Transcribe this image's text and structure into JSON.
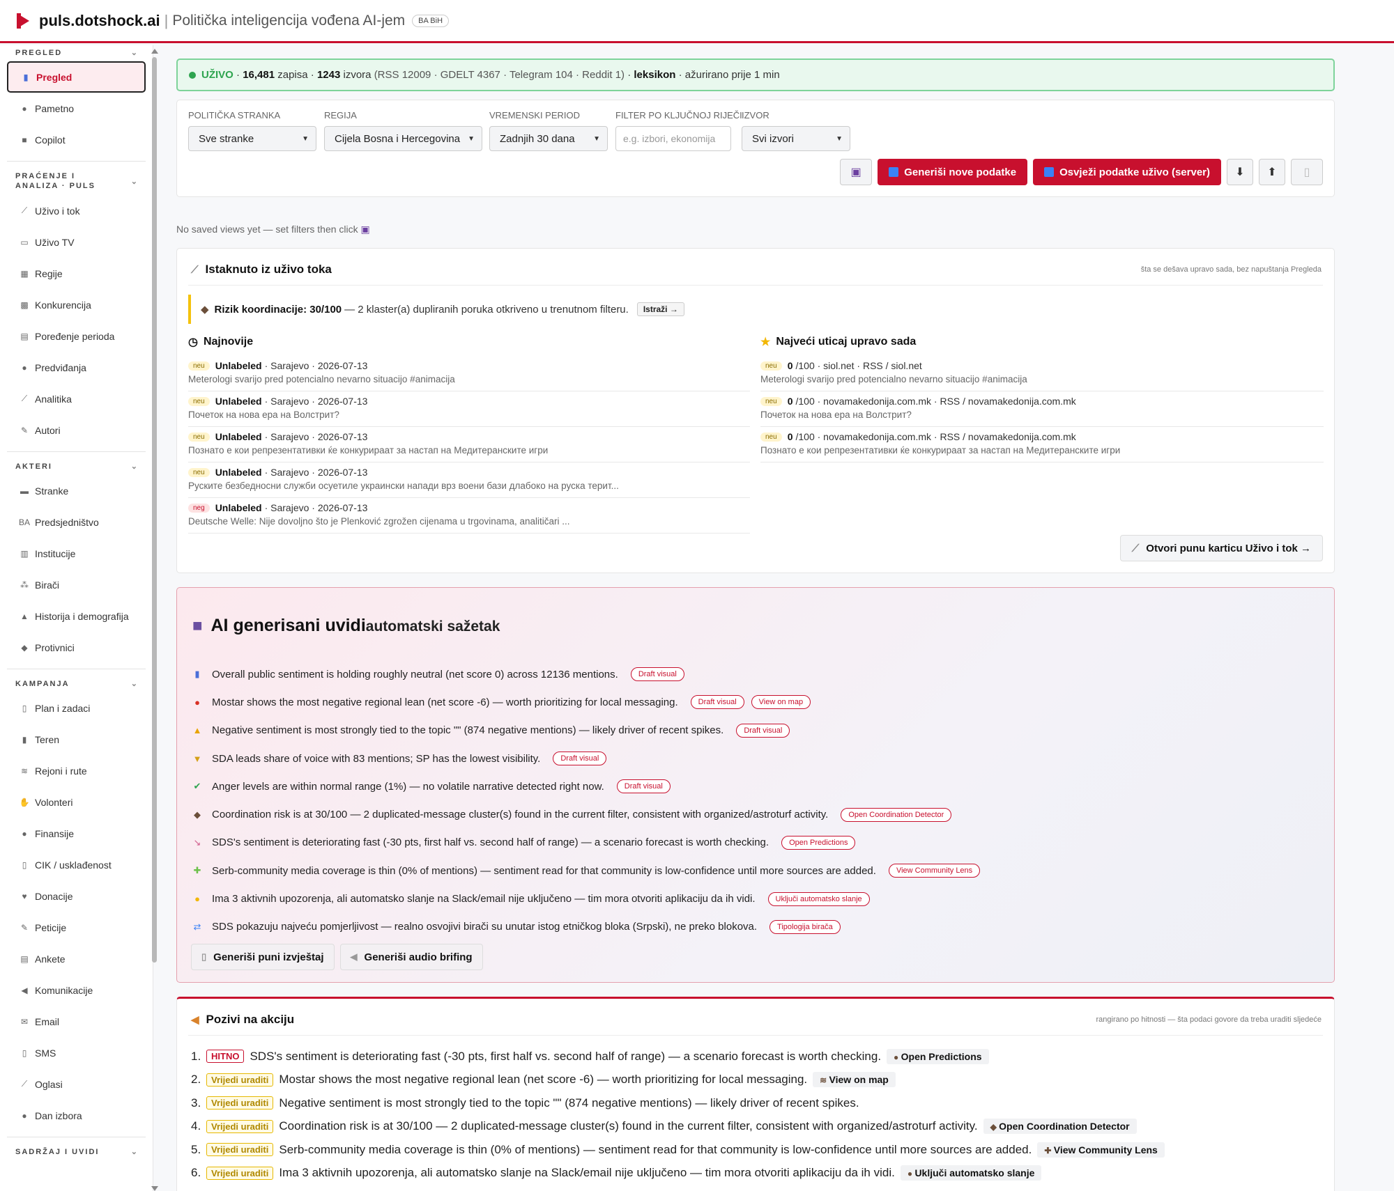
{
  "header": {
    "brand": "puls.dotshock.ai",
    "separator": "|",
    "tagline": "Politička inteligencija vođena AI-jem",
    "country_badge": "BA BiH"
  },
  "sidebar": {
    "sections": [
      {
        "title": "PREGLED",
        "items": [
          {
            "label": "Pregled",
            "icon": "chart-icon",
            "glyph": "▮",
            "active": true
          },
          {
            "label": "Pametno",
            "icon": "brain-icon",
            "glyph": "●"
          },
          {
            "label": "Copilot",
            "icon": "robot-icon",
            "glyph": "■"
          }
        ]
      },
      {
        "title": "PRAĆENJE I ANALIZA · PULS",
        "items": [
          {
            "label": "Uživo i tok",
            "icon": "satellite-icon",
            "glyph": "⟋"
          },
          {
            "label": "Uživo TV",
            "icon": "tv-icon",
            "glyph": "▭"
          },
          {
            "label": "Regije",
            "icon": "map-icon",
            "glyph": "▦"
          },
          {
            "label": "Konkurencija",
            "icon": "checkered-flag-icon",
            "glyph": "▩"
          },
          {
            "label": "Poređenje perioda",
            "icon": "calendar-icon",
            "glyph": "▤"
          },
          {
            "label": "Predviđanja",
            "icon": "crystal-ball-icon",
            "glyph": "●"
          },
          {
            "label": "Analitika",
            "icon": "line-chart-icon",
            "glyph": "⟋"
          },
          {
            "label": "Autori",
            "icon": "pen-icon",
            "glyph": "✎"
          }
        ]
      },
      {
        "title": "AKTERI",
        "items": [
          {
            "label": "Stranke",
            "icon": "building-icon",
            "glyph": "▬"
          },
          {
            "label": "Predsjedništvo",
            "icon": "ba-flag-icon",
            "glyph": "BA"
          },
          {
            "label": "Institucije",
            "icon": "office-icon",
            "glyph": "▥"
          },
          {
            "label": "Birači",
            "icon": "people-icon",
            "glyph": "⁂"
          },
          {
            "label": "Historija i demografija",
            "icon": "mountain-icon",
            "glyph": "▲"
          },
          {
            "label": "Protivnici",
            "icon": "detective-icon",
            "glyph": "◆"
          }
        ]
      },
      {
        "title": "KAMPANJA",
        "items": [
          {
            "label": "Plan i zadaci",
            "icon": "clipboard-icon",
            "glyph": "▯"
          },
          {
            "label": "Teren",
            "icon": "door-icon",
            "glyph": "▮"
          },
          {
            "label": "Rejoni i rute",
            "icon": "world-map-icon",
            "glyph": "≋"
          },
          {
            "label": "Volonteri",
            "icon": "hand-icon",
            "glyph": "✋"
          },
          {
            "label": "Finansije",
            "icon": "money-bag-icon",
            "glyph": "●"
          },
          {
            "label": "CIK / usklađenost",
            "icon": "scroll-icon",
            "glyph": "▯"
          },
          {
            "label": "Donacije",
            "icon": "heart-icon",
            "glyph": "♥"
          },
          {
            "label": "Peticije",
            "icon": "pen-icon",
            "glyph": "✎"
          },
          {
            "label": "Ankete",
            "icon": "ballot-icon",
            "glyph": "▤"
          },
          {
            "label": "Komunikacije",
            "icon": "megaphone-icon",
            "glyph": "◀"
          },
          {
            "label": "Email",
            "icon": "envelope-icon",
            "glyph": "✉"
          },
          {
            "label": "SMS",
            "icon": "phone-icon",
            "glyph": "▯"
          },
          {
            "label": "Oglasi",
            "icon": "satellite-icon",
            "glyph": "⟋"
          },
          {
            "label": "Dan izbora",
            "icon": "ballot-box-icon",
            "glyph": "●"
          }
        ]
      },
      {
        "title": "SADRŽAJ I UVIDI",
        "items": []
      }
    ]
  },
  "live": {
    "status": "UŽIVO",
    "records_count": "16,481",
    "records_label": "zapisa",
    "sources_count": "1243",
    "sources_label": "izvora",
    "breakdown": "(RSS 12009 · GDELT 4367 · Telegram 104 · Reddit 1)",
    "mode": "leksikon",
    "updated": "ažurirano prije 1 min"
  },
  "filters": {
    "party": {
      "label": "POLITIČKA STRANKA",
      "value": "Sve stranke"
    },
    "region": {
      "label": "REGIJA",
      "value": "Cijela Bosna i Hercegovina"
    },
    "period": {
      "label": "VREMENSKI PERIOD",
      "value": "Zadnjih 30 dana"
    },
    "keyword": {
      "label": "FILTER PO KLJUČNOJ RIJEČI",
      "placeholder": "e.g. izbori, ekonomija"
    },
    "source": {
      "label": "IZVOR",
      "value": "Svi izvori"
    },
    "generate_button": "Generiši nove podatke",
    "refresh_button": "Osvježi podatke uživo (server)"
  },
  "saved_views_note": "No saved views yet — set filters then click",
  "highlights": {
    "title": "Istaknuto iz uživo toka",
    "subtitle": "šta se dešava upravo sada, bez napuštanja Pregleda",
    "coordination": {
      "label": "Rizik koordinacije: 30/100",
      "text": "— 2 klaster(a) dupliranih poruka otkriveno u trenutnom filteru.",
      "button": "Istraži →"
    },
    "latest_title": "Najnovije",
    "latest": [
      {
        "tag": "neu",
        "author": "Unlabeled",
        "meta": "· Sarajevo · 2026-07-13",
        "text": "Meterologi svarijo pred potencialno nevarno situacijo #animacija"
      },
      {
        "tag": "neu",
        "author": "Unlabeled",
        "meta": "· Sarajevo · 2026-07-13",
        "text": "Почеток на нова ера на Волстрит?"
      },
      {
        "tag": "neu",
        "author": "Unlabeled",
        "meta": "· Sarajevo · 2026-07-13",
        "text": "Познато е кои репрезентативки ќе конкурираат за настап на Медитеранските игри"
      },
      {
        "tag": "neu",
        "author": "Unlabeled",
        "meta": "· Sarajevo · 2026-07-13",
        "text": "Руските безбедносни служби осуетиле украински напади врз воени бази длабоко на руска терит..."
      },
      {
        "tag": "neg",
        "author": "Unlabeled",
        "meta": "· Sarajevo · 2026-07-13",
        "text": "Deutsche Welle: Nije dovoljno što je Plenković zgrožen cijenama u trgovinama, analitičari ..."
      }
    ],
    "impact_title": "Najveći uticaj upravo sada",
    "impact": [
      {
        "tag": "neu",
        "score": "0",
        "meta": "/100 · siol.net · RSS / siol.net",
        "text": "Meterologi svarijo pred potencialno nevarno situacijo #animacija"
      },
      {
        "tag": "neu",
        "score": "0",
        "meta": "/100 · novamakedonija.com.mk · RSS / novamakedonija.com.mk",
        "text": "Почеток на нова ера на Волстрит?"
      },
      {
        "tag": "neu",
        "score": "0",
        "meta": "/100 · novamakedonija.com.mk · RSS / novamakedonija.com.mk",
        "text": "Познато е кои репрезентативки ќе конкурираат за настап на Медитеранските игри"
      }
    ],
    "open_button": "Otvori punu karticu Uživo i tok →"
  },
  "ai": {
    "title": "AI generisani uvidi",
    "subtitle": "automatski sažetak",
    "insights": [
      {
        "icon": "bar-chart-icon",
        "glyph": "▮",
        "color": "#4a6fd8",
        "text": "Overall public sentiment is holding roughly neutral (net score 0) across 12136 mentions.",
        "actions": [
          "Draft visual"
        ]
      },
      {
        "icon": "pin-icon",
        "glyph": "●",
        "color": "#d93025",
        "text": "Mostar shows the most negative regional lean (net score -6) — worth prioritizing for local messaging.",
        "actions": [
          "Draft visual",
          "View on map"
        ]
      },
      {
        "icon": "warning-icon",
        "glyph": "▲",
        "color": "#e8a400",
        "text": "Negative sentiment is most strongly tied to the topic \"\" (874 negative mentions) — likely driver of recent spikes.",
        "actions": [
          "Draft visual"
        ]
      },
      {
        "icon": "trophy-icon",
        "glyph": "▼",
        "color": "#d4a017",
        "text": "SDA leads share of voice with 83 mentions; SP has the lowest visibility.",
        "actions": [
          "Draft visual"
        ]
      },
      {
        "icon": "check-icon",
        "glyph": "✔",
        "color": "#2ea44f",
        "text": "Anger levels are within normal range (1%) — no volatile narrative detected right now.",
        "actions": [
          "Draft visual"
        ]
      },
      {
        "icon": "detective-icon",
        "glyph": "◆",
        "color": "#6b4f3a",
        "text": "Coordination risk is at 30/100 — 2 duplicated-message cluster(s) found in the current filter, consistent with organized/astroturf activity.",
        "actions": [
          "Open Coordination Detector"
        ]
      },
      {
        "icon": "trend-down-icon",
        "glyph": "↘",
        "color": "#d05a8a",
        "text": "SDS's sentiment is deteriorating fast (-30 pts, first half vs. second half of range) — a scenario forecast is worth checking.",
        "actions": [
          "Open Predictions"
        ]
      },
      {
        "icon": "puzzle-icon",
        "glyph": "✚",
        "color": "#6cc04a",
        "text": "Serb-community media coverage is thin (0% of mentions) — sentiment read for that community is low-confidence until more sources are added.",
        "actions": [
          "View Community Lens"
        ]
      },
      {
        "icon": "bell-icon",
        "glyph": "●",
        "color": "#f2b705",
        "text": "Ima 3 aktivnih upozorenja, ali automatsko slanje na Slack/email nije uključeno — tim mora otvoriti aplikaciju da ih vidi.",
        "actions": [
          "Uključi automatsko slanje"
        ]
      },
      {
        "icon": "swap-icon",
        "glyph": "⇄",
        "color": "#3b82f6",
        "text": "SDS pokazuju najveću pomjerljivost — realno osvojivi birači su unutar istog etničkog bloka (Srpski), ne preko blokova.",
        "actions": [
          "Tipologija birača"
        ]
      }
    ],
    "report_button": "Generiši puni izvještaj",
    "audio_button": "Generiši audio brifing"
  },
  "actions": {
    "title": "Pozivi na akciju",
    "subtitle": "rangirano po hitnosti — šta podaci govore da treba uraditi sljedeće",
    "items": [
      {
        "num": "1.",
        "priority": "HITNO",
        "level": "urgent",
        "text": "SDS's sentiment is deteriorating fast (-30 pts, first half vs. second half of range) — a scenario forecast is worth checking.",
        "button": "Open Predictions",
        "btn_icon": "crystal-ball-icon",
        "btn_glyph": "●"
      },
      {
        "num": "2.",
        "priority": "Vrijedi uraditi",
        "level": "worth",
        "text": "Mostar shows the most negative regional lean (net score -6) — worth prioritizing for local messaging.",
        "button": "View on map",
        "btn_icon": "world-map-icon",
        "btn_glyph": "≋"
      },
      {
        "num": "3.",
        "priority": "Vrijedi uraditi",
        "level": "worth",
        "text": "Negative sentiment is most strongly tied to the topic \"\" (874 negative mentions) — likely driver of recent spikes.",
        "button": "",
        "btn_icon": "",
        "btn_glyph": ""
      },
      {
        "num": "4.",
        "priority": "Vrijedi uraditi",
        "level": "worth",
        "text": "Coordination risk is at 30/100 — 2 duplicated-message cluster(s) found in the current filter, consistent with organized/astroturf activity.",
        "button": "Open Coordination Detector",
        "btn_icon": "detective-icon",
        "btn_glyph": "◆"
      },
      {
        "num": "5.",
        "priority": "Vrijedi uraditi",
        "level": "worth",
        "text": "Serb-community media coverage is thin (0% of mentions) — sentiment read for that community is low-confidence until more sources are added.",
        "button": "View Community Lens",
        "btn_icon": "puzzle-icon",
        "btn_glyph": "✚"
      },
      {
        "num": "6.",
        "priority": "Vrijedi uraditi",
        "level": "worth",
        "text": "Ima 3 aktivnih upozorenja, ali automatsko slanje na Slack/email nije uključeno — tim mora otvoriti aplikaciju da ih vidi.",
        "button": "Uključi automatsko slanje",
        "btn_icon": "bell-icon",
        "btn_glyph": "●"
      }
    ]
  }
}
